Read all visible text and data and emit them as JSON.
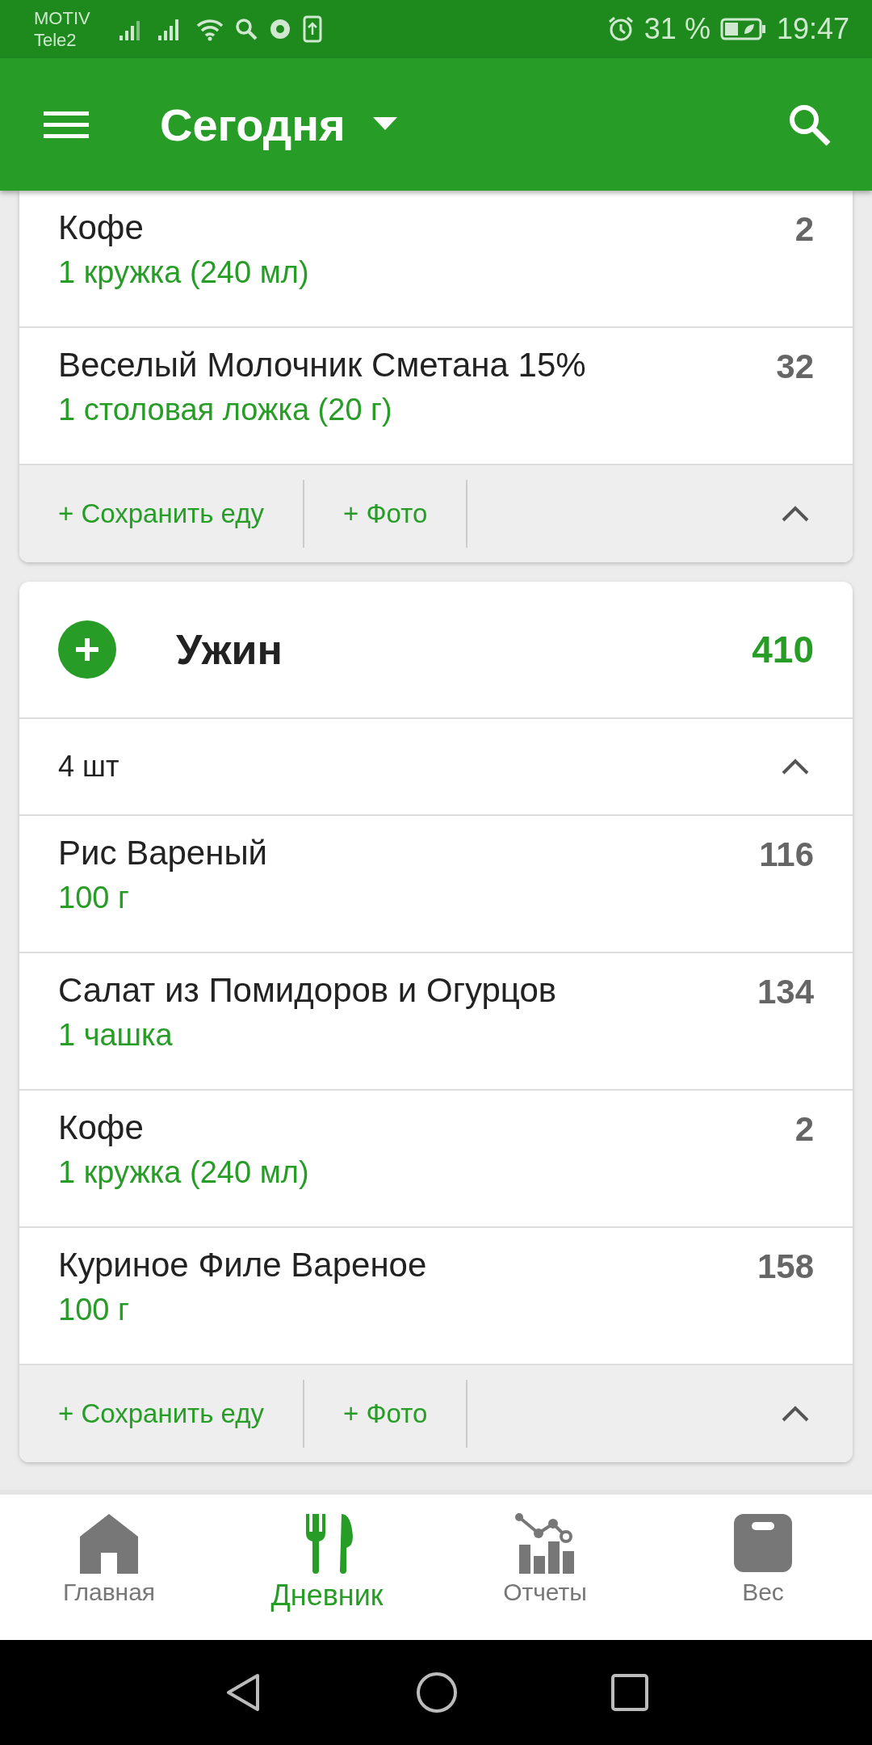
{
  "status_bar": {
    "carrier": "MOTIV",
    "carrier_2": "Tele2",
    "battery": "31 %",
    "time": "19:47"
  },
  "app_bar": {
    "title": "Сегодня"
  },
  "cards": [
    {
      "items": [
        {
          "name": "Кофе",
          "portion": "1  кружка (240 мл)",
          "calories": "2"
        },
        {
          "name": "Веселый Молочник Сметана 15%",
          "portion": "1 столовая ложка (20 г)",
          "calories": "32"
        }
      ],
      "footer": {
        "save": "+ Сохранить еду",
        "photo": "+ Фото",
        "expanded": true
      }
    },
    {
      "header": {
        "title": "Ужин",
        "calories": "410"
      },
      "count": {
        "label": "4 шт",
        "expanded": true
      },
      "items": [
        {
          "name": "Рис Вареный",
          "portion": "100  г",
          "calories": "116"
        },
        {
          "name": "Салат из Помидоров и Огурцов",
          "portion": "1  чашка",
          "calories": "134"
        },
        {
          "name": "Кофе",
          "portion": "1  кружка (240 мл)",
          "calories": "2"
        },
        {
          "name": "Куриное Филе Вареное",
          "portion": "100  г",
          "calories": "158"
        }
      ],
      "footer": {
        "save": "+ Сохранить еду",
        "photo": "+ Фото",
        "expanded": true
      }
    }
  ],
  "nav": [
    {
      "kind": "home",
      "label": "Главная",
      "selected": false
    },
    {
      "kind": "diary",
      "label": "Дневник",
      "selected": true
    },
    {
      "kind": "reports",
      "label": "Отчеты",
      "selected": false
    },
    {
      "kind": "weight",
      "label": "Вес",
      "selected": false
    }
  ]
}
